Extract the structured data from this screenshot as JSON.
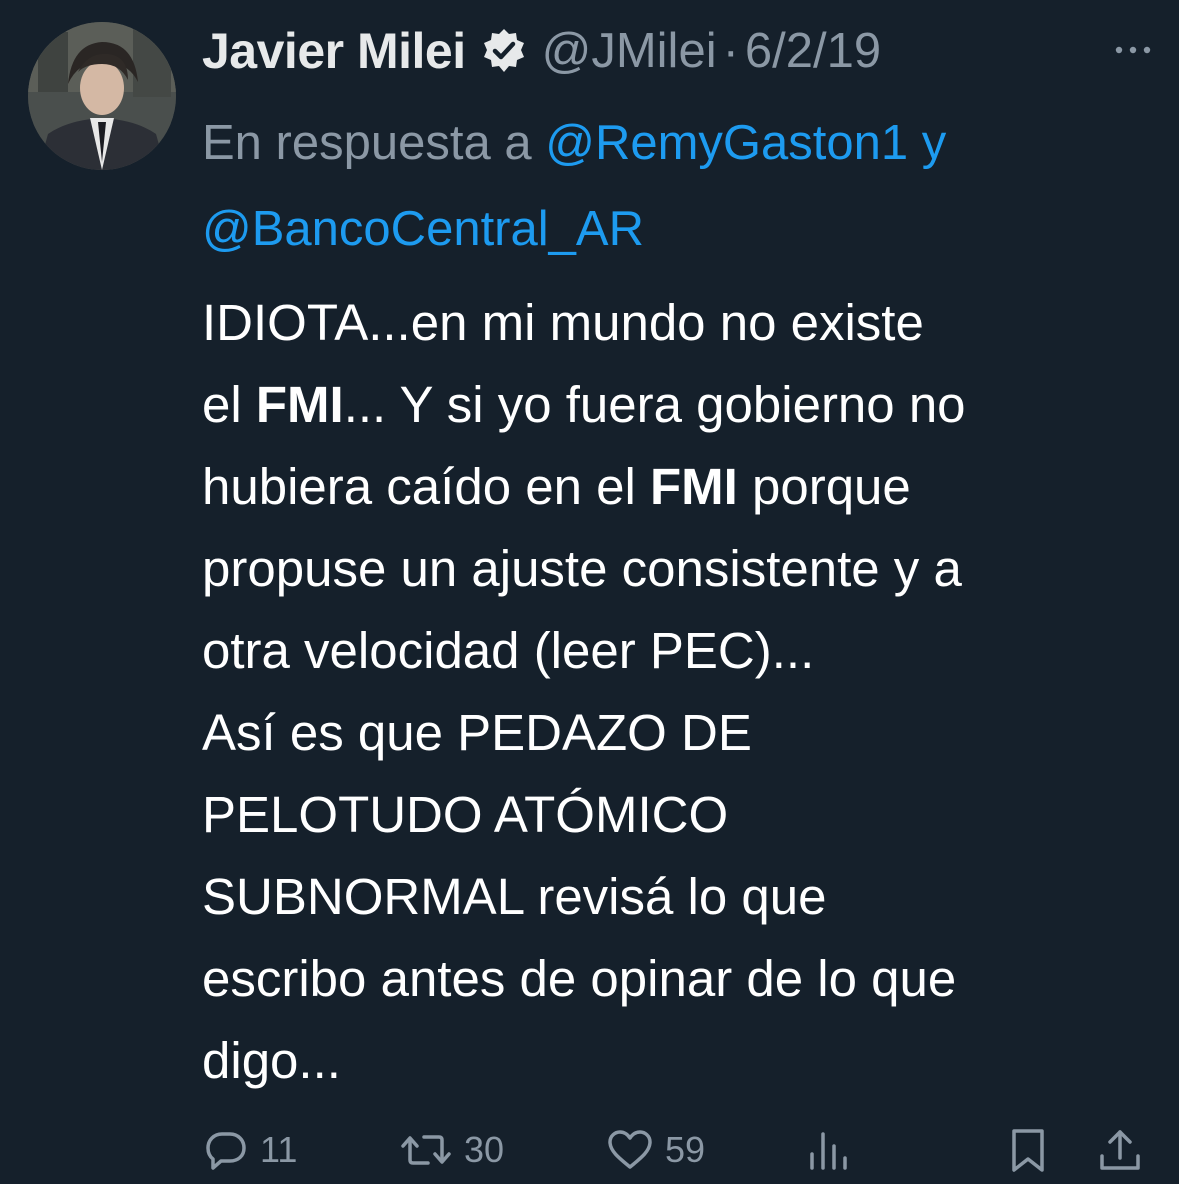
{
  "tweet": {
    "author_name": "Javier Milei",
    "handle": "@JMilei",
    "separator": "·",
    "date": "6/2/19",
    "more_icon": "more-dots-icon",
    "verified_icon": "verified-badge-icon",
    "reply_to": {
      "prefix": "En respuesta a ",
      "mention_1": "@RemyGaston1",
      "joiner": " y",
      "mention_2": "@BancoCentral_AR"
    },
    "body": {
      "line1": "IDIOTA...en mi mundo no existe",
      "line2_a": "el ",
      "line2_bold": "FMI",
      "line2_b": "... Y si yo fuera gobierno no",
      "line3_a": "hubiera caído en el ",
      "line3_bold": "FMI",
      "line3_b": " porque",
      "line4": "propuse un ajuste consistente y a",
      "line5": "otra velocidad (leer PEC)...",
      "line6": "Así es que PEDAZO DE",
      "line7": "PELOTUDO ATÓMICO",
      "line8": "SUBNORMAL revisá lo que",
      "line9": "escribo antes de opinar de lo que",
      "line10": "digo..."
    },
    "actions": {
      "replies": "11",
      "retweets": "30",
      "likes": "59"
    },
    "colors": {
      "background": "#15202b",
      "link": "#1d9bf0",
      "muted": "#8b98a5",
      "text": "#ffffff"
    }
  }
}
